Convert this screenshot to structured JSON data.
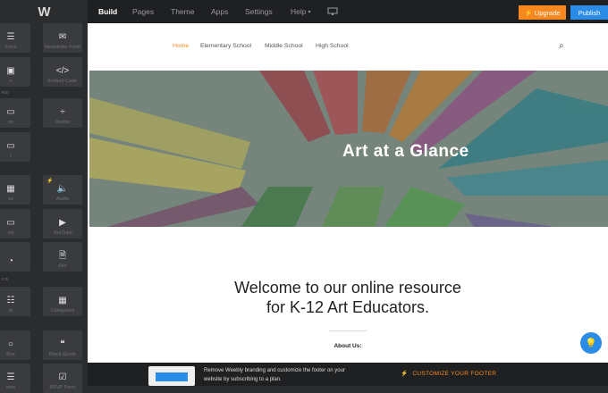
{
  "topbar": {
    "logo": "W",
    "tabs": [
      "Build",
      "Pages",
      "Theme",
      "Apps",
      "Settings",
      "Help"
    ],
    "help_caret": "▾",
    "device_icon": "monitor-icon",
    "upgrade_label": "Upgrade",
    "publish_label": "Publish"
  },
  "sidebar": {
    "tiles": [
      {
        "label": "Form",
        "icon": "form-icon"
      },
      {
        "label": "Newsletter Form",
        "icon": "envelope-icon"
      },
      {
        "label": "n",
        "icon": "map-icon"
      },
      {
        "label": "Embed Code",
        "icon": "code-icon"
      },
      {
        "label": "RE",
        "icon": "section-label"
      },
      {
        "label": "on",
        "icon": "button-icon"
      },
      {
        "label": "Divider",
        "icon": "divider-icon"
      },
      {
        "label": "r",
        "icon": "spacer-icon"
      },
      {
        "label": "ss",
        "icon": "slideshow-icon"
      },
      {
        "label": "Audio",
        "icon": "speaker-icon"
      },
      {
        "label": "ed",
        "icon": "video-icon"
      },
      {
        "label": "YouTube",
        "icon": "play-icon"
      },
      {
        "label": "",
        "icon": "document-icon"
      },
      {
        "label": "File",
        "icon": "file-icon"
      },
      {
        "label": "CE",
        "icon": "section-label"
      },
      {
        "label": "ts",
        "icon": "products-icon"
      },
      {
        "label": "Categories",
        "icon": "categories-icon"
      },
      {
        "label": "Box",
        "icon": "search-box-icon"
      },
      {
        "label": "Block Quote",
        "icon": "quote-icon"
      },
      {
        "label": "ents",
        "icon": "comments-icon"
      },
      {
        "label": "RSVP Form",
        "icon": "rsvp-icon"
      }
    ]
  },
  "site": {
    "nav": [
      "Home",
      "Elementary School",
      "Middle School",
      "High School"
    ],
    "hero_title": "Art at a Glance",
    "welcome_line1": "Welcome to our online resource",
    "welcome_line2": "for K-12 Art Educators.",
    "about": "About Us:"
  },
  "footer": {
    "text_line1": "Remove Weebly branding and customize the footer on your",
    "text_line2": "website by subscribing to a plan.",
    "cta": "CUSTOMIZE YOUR FOOTER"
  },
  "colors": {
    "accent": "#f7881f",
    "brand": "#2b8ce8",
    "sidebar": "#2b2c2e"
  }
}
